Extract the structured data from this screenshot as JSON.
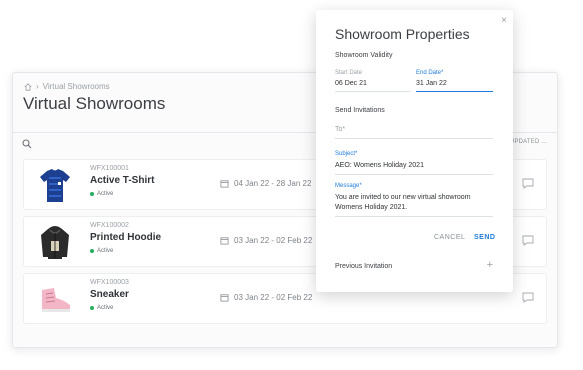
{
  "main": {
    "breadcrumb": "Virtual Showrooms",
    "title": "Virtual Showrooms",
    "sort_label": "T UPDATED ...",
    "rows": [
      {
        "code": "WFX100001",
        "name": "Active T-Shirt",
        "status": "Active",
        "dates": "04 Jan 22 - 28 Jan 22",
        "image": "tshirt-icon"
      },
      {
        "code": "WFX100002",
        "name": "Printed Hoodie",
        "status": "Active",
        "dates": "03 Jan 22 - 02 Feb 22",
        "image": "hoodie-icon"
      },
      {
        "code": "WFX100003",
        "name": "Sneaker",
        "status": "Active",
        "dates": "03 Jan 22 - 02 Feb 22",
        "image": "sneaker-icon"
      }
    ]
  },
  "modal": {
    "title": "Showroom Properties",
    "validity_label": "Showroom Validity",
    "start_label": "Start Date",
    "start_value": "06 Dec 21",
    "end_label": "End Date*",
    "end_value": "31 Jan 22",
    "invitations_label": "Send Invitations",
    "to_placeholder": "To*",
    "subject_label": "Subject*",
    "subject_value": "AEO: Womens Holiday 2021",
    "message_label": "Message*",
    "message_value": "You are invited to our new virtual showroom Womens Holiday 2021.",
    "cancel": "CANCEL",
    "send": "SEND",
    "previous": "Previous Invitation",
    "plus": "+",
    "close": "×"
  },
  "colors": {
    "accent": "#1f7bd8",
    "active": "#27ae60"
  }
}
